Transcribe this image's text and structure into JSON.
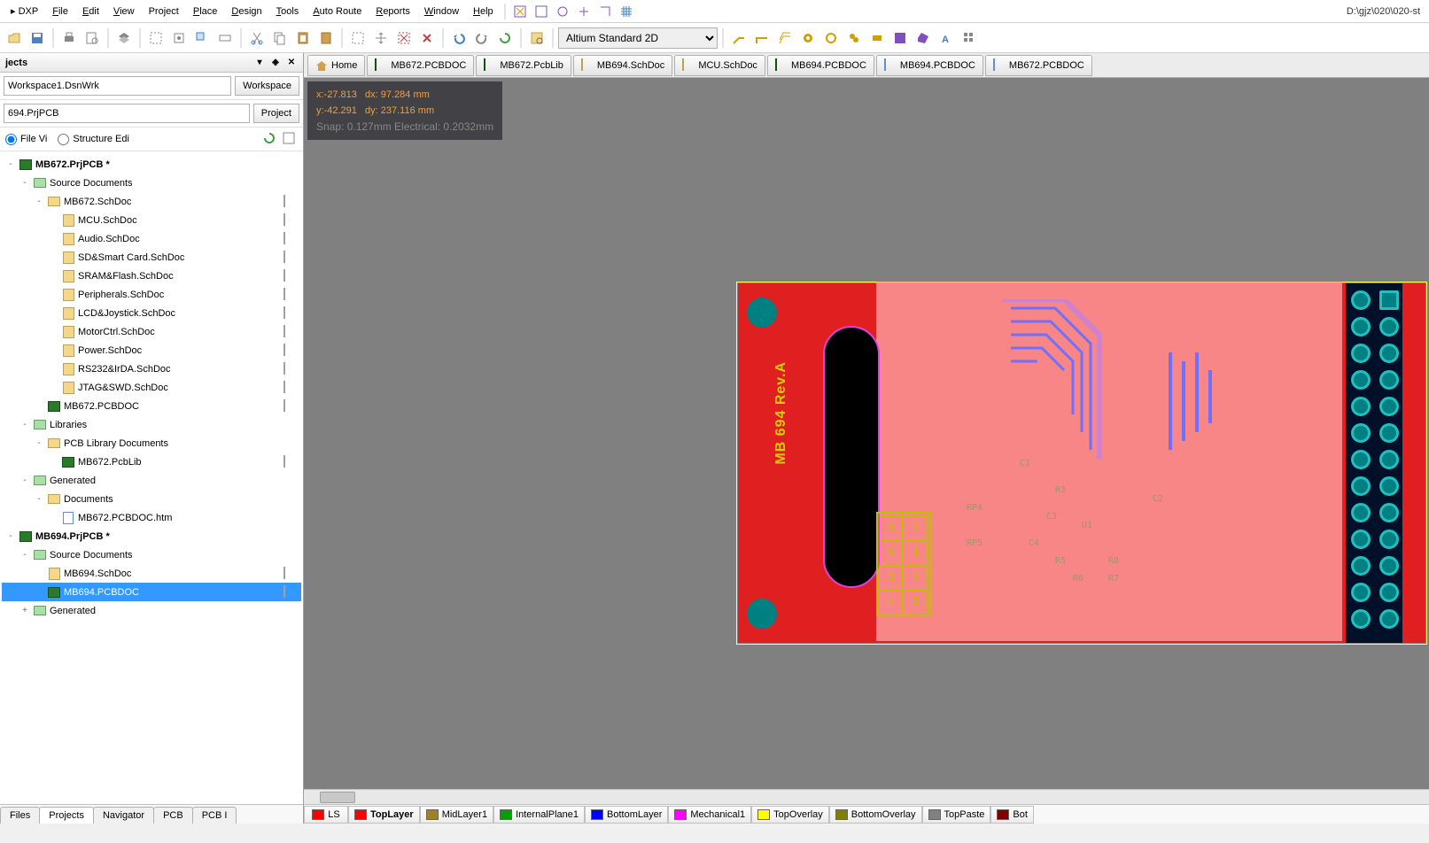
{
  "path_display": "D:\\gjz\\020\\020-st",
  "menu": [
    "DXP",
    "File",
    "Edit",
    "View",
    "Project",
    "Place",
    "Design",
    "Tools",
    "Auto Route",
    "Reports",
    "Window",
    "Help"
  ],
  "view_mode_select": "Altium Standard 2D",
  "projects_panel": {
    "title": "jects",
    "workspace_value": "Workspace1.DsnWrk",
    "workspace_btn": "Workspace",
    "project_value": "694.PrjPCB",
    "project_btn": "Project",
    "radio_file": "File Vi",
    "radio_struct": "Structure Edi"
  },
  "tree": [
    {
      "d": 0,
      "exp": "-",
      "ic": "prj",
      "lbl": "MB672.PrjPCB *",
      "bold": true,
      "ric": "red"
    },
    {
      "d": 1,
      "exp": "-",
      "ic": "folder-g",
      "lbl": "Source Documents"
    },
    {
      "d": 2,
      "exp": "-",
      "ic": "folder",
      "lbl": "MB672.SchDoc",
      "ric": "doc"
    },
    {
      "d": 3,
      "exp": "",
      "ic": "sch",
      "lbl": "MCU.SchDoc",
      "ric": "doc"
    },
    {
      "d": 3,
      "exp": "",
      "ic": "sch",
      "lbl": "Audio.SchDoc",
      "ric": "doc"
    },
    {
      "d": 3,
      "exp": "",
      "ic": "sch",
      "lbl": "SD&Smart Card.SchDoc",
      "ric": "doc"
    },
    {
      "d": 3,
      "exp": "",
      "ic": "sch",
      "lbl": "SRAM&Flash.SchDoc",
      "ric": "doc"
    },
    {
      "d": 3,
      "exp": "",
      "ic": "sch",
      "lbl": "Peripherals.SchDoc",
      "ric": "doc"
    },
    {
      "d": 3,
      "exp": "",
      "ic": "sch",
      "lbl": "LCD&Joystick.SchDoc",
      "ric": "doc"
    },
    {
      "d": 3,
      "exp": "",
      "ic": "sch",
      "lbl": "MotorCtrl.SchDoc",
      "ric": "doc"
    },
    {
      "d": 3,
      "exp": "",
      "ic": "sch",
      "lbl": "Power.SchDoc",
      "ric": "doc"
    },
    {
      "d": 3,
      "exp": "",
      "ic": "sch",
      "lbl": "RS232&IrDA.SchDoc",
      "ric": "doc"
    },
    {
      "d": 3,
      "exp": "",
      "ic": "sch",
      "lbl": "JTAG&SWD.SchDoc",
      "ric": "doc"
    },
    {
      "d": 2,
      "exp": "",
      "ic": "pcb",
      "lbl": "MB672.PCBDOC",
      "ric": "doc"
    },
    {
      "d": 1,
      "exp": "-",
      "ic": "folder-g",
      "lbl": "Libraries"
    },
    {
      "d": 2,
      "exp": "-",
      "ic": "folder",
      "lbl": "PCB Library Documents"
    },
    {
      "d": 3,
      "exp": "",
      "ic": "pcb",
      "lbl": "MB672.PcbLib",
      "ric": "doc"
    },
    {
      "d": 1,
      "exp": "-",
      "ic": "folder-g",
      "lbl": "Generated"
    },
    {
      "d": 2,
      "exp": "-",
      "ic": "folder",
      "lbl": "Documents"
    },
    {
      "d": 3,
      "exp": "",
      "ic": "htm",
      "lbl": "MB672.PCBDOC.htm"
    },
    {
      "d": 0,
      "exp": "-",
      "ic": "prj",
      "lbl": "MB694.PrjPCB *",
      "bold": true,
      "ric": "red"
    },
    {
      "d": 1,
      "exp": "-",
      "ic": "folder-g",
      "lbl": "Source Documents"
    },
    {
      "d": 2,
      "exp": "",
      "ic": "sch",
      "lbl": "MB694.SchDoc",
      "ric": "doc"
    },
    {
      "d": 2,
      "exp": "",
      "ic": "pcb",
      "lbl": "MB694.PCBDOC",
      "ric": "doc",
      "sel": true
    },
    {
      "d": 1,
      "exp": "+",
      "ic": "folder-g",
      "lbl": "Generated"
    }
  ],
  "bottom_tabs": [
    "Files",
    "Projects",
    "Navigator",
    "PCB",
    "PCB I"
  ],
  "bottom_tab_active": 1,
  "doc_tabs": [
    {
      "ic": "home",
      "lbl": "Home"
    },
    {
      "ic": "pcb",
      "lbl": "MB672.PCBDOC"
    },
    {
      "ic": "pcb",
      "lbl": "MB672.PcbLib"
    },
    {
      "ic": "sch",
      "lbl": "MB694.SchDoc"
    },
    {
      "ic": "sch",
      "lbl": "MCU.SchDoc"
    },
    {
      "ic": "pcb",
      "lbl": "MB694.PCBDOC"
    },
    {
      "ic": "htm",
      "lbl": "MB694.PCBDOC"
    },
    {
      "ic": "htm",
      "lbl": "MB672.PCBDOC"
    }
  ],
  "coords": {
    "x": "x:-27.813",
    "dx": "dx: 97.284  mm",
    "y": "y:-42.291",
    "dy": "dy: 237.116 mm",
    "snap": "Snap: 0.127mm Electrical: 0.2032mm"
  },
  "board_silk": "MB 694  Rev.A",
  "layer_ls": "LS",
  "layers": [
    {
      "c": "#ff0000",
      "n": "TopLayer",
      "act": true
    },
    {
      "c": "#a08020",
      "n": "MidLayer1"
    },
    {
      "c": "#00a000",
      "n": "InternalPlane1"
    },
    {
      "c": "#0000ff",
      "n": "BottomLayer"
    },
    {
      "c": "#ff00ff",
      "n": "Mechanical1"
    },
    {
      "c": "#ffff00",
      "n": "TopOverlay"
    },
    {
      "c": "#808000",
      "n": "BottomOverlay"
    },
    {
      "c": "#808080",
      "n": "TopPaste"
    },
    {
      "c": "#800000",
      "n": "Bot"
    }
  ]
}
